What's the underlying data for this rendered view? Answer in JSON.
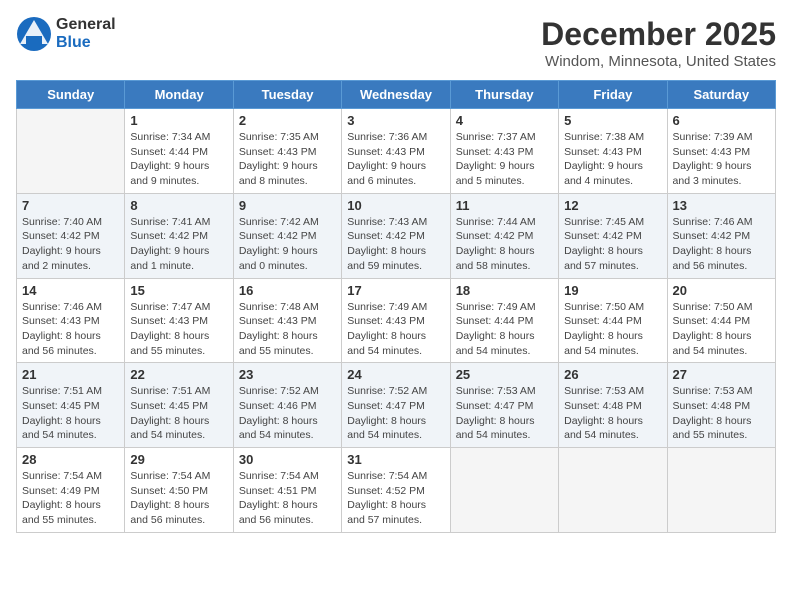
{
  "logo": {
    "general": "General",
    "blue": "Blue"
  },
  "header": {
    "title": "December 2025",
    "subtitle": "Windom, Minnesota, United States"
  },
  "weekdays": [
    "Sunday",
    "Monday",
    "Tuesday",
    "Wednesday",
    "Thursday",
    "Friday",
    "Saturday"
  ],
  "weeks": [
    [
      {
        "day": "",
        "empty": true
      },
      {
        "day": "1",
        "sunrise": "Sunrise: 7:34 AM",
        "sunset": "Sunset: 4:44 PM",
        "daylight": "Daylight: 9 hours and 9 minutes."
      },
      {
        "day": "2",
        "sunrise": "Sunrise: 7:35 AM",
        "sunset": "Sunset: 4:43 PM",
        "daylight": "Daylight: 9 hours and 8 minutes."
      },
      {
        "day": "3",
        "sunrise": "Sunrise: 7:36 AM",
        "sunset": "Sunset: 4:43 PM",
        "daylight": "Daylight: 9 hours and 6 minutes."
      },
      {
        "day": "4",
        "sunrise": "Sunrise: 7:37 AM",
        "sunset": "Sunset: 4:43 PM",
        "daylight": "Daylight: 9 hours and 5 minutes."
      },
      {
        "day": "5",
        "sunrise": "Sunrise: 7:38 AM",
        "sunset": "Sunset: 4:43 PM",
        "daylight": "Daylight: 9 hours and 4 minutes."
      },
      {
        "day": "6",
        "sunrise": "Sunrise: 7:39 AM",
        "sunset": "Sunset: 4:43 PM",
        "daylight": "Daylight: 9 hours and 3 minutes."
      }
    ],
    [
      {
        "day": "7",
        "sunrise": "Sunrise: 7:40 AM",
        "sunset": "Sunset: 4:42 PM",
        "daylight": "Daylight: 9 hours and 2 minutes."
      },
      {
        "day": "8",
        "sunrise": "Sunrise: 7:41 AM",
        "sunset": "Sunset: 4:42 PM",
        "daylight": "Daylight: 9 hours and 1 minute."
      },
      {
        "day": "9",
        "sunrise": "Sunrise: 7:42 AM",
        "sunset": "Sunset: 4:42 PM",
        "daylight": "Daylight: 9 hours and 0 minutes."
      },
      {
        "day": "10",
        "sunrise": "Sunrise: 7:43 AM",
        "sunset": "Sunset: 4:42 PM",
        "daylight": "Daylight: 8 hours and 59 minutes."
      },
      {
        "day": "11",
        "sunrise": "Sunrise: 7:44 AM",
        "sunset": "Sunset: 4:42 PM",
        "daylight": "Daylight: 8 hours and 58 minutes."
      },
      {
        "day": "12",
        "sunrise": "Sunrise: 7:45 AM",
        "sunset": "Sunset: 4:42 PM",
        "daylight": "Daylight: 8 hours and 57 minutes."
      },
      {
        "day": "13",
        "sunrise": "Sunrise: 7:46 AM",
        "sunset": "Sunset: 4:42 PM",
        "daylight": "Daylight: 8 hours and 56 minutes."
      }
    ],
    [
      {
        "day": "14",
        "sunrise": "Sunrise: 7:46 AM",
        "sunset": "Sunset: 4:43 PM",
        "daylight": "Daylight: 8 hours and 56 minutes."
      },
      {
        "day": "15",
        "sunrise": "Sunrise: 7:47 AM",
        "sunset": "Sunset: 4:43 PM",
        "daylight": "Daylight: 8 hours and 55 minutes."
      },
      {
        "day": "16",
        "sunrise": "Sunrise: 7:48 AM",
        "sunset": "Sunset: 4:43 PM",
        "daylight": "Daylight: 8 hours and 55 minutes."
      },
      {
        "day": "17",
        "sunrise": "Sunrise: 7:49 AM",
        "sunset": "Sunset: 4:43 PM",
        "daylight": "Daylight: 8 hours and 54 minutes."
      },
      {
        "day": "18",
        "sunrise": "Sunrise: 7:49 AM",
        "sunset": "Sunset: 4:44 PM",
        "daylight": "Daylight: 8 hours and 54 minutes."
      },
      {
        "day": "19",
        "sunrise": "Sunrise: 7:50 AM",
        "sunset": "Sunset: 4:44 PM",
        "daylight": "Daylight: 8 hours and 54 minutes."
      },
      {
        "day": "20",
        "sunrise": "Sunrise: 7:50 AM",
        "sunset": "Sunset: 4:44 PM",
        "daylight": "Daylight: 8 hours and 54 minutes."
      }
    ],
    [
      {
        "day": "21",
        "sunrise": "Sunrise: 7:51 AM",
        "sunset": "Sunset: 4:45 PM",
        "daylight": "Daylight: 8 hours and 54 minutes."
      },
      {
        "day": "22",
        "sunrise": "Sunrise: 7:51 AM",
        "sunset": "Sunset: 4:45 PM",
        "daylight": "Daylight: 8 hours and 54 minutes."
      },
      {
        "day": "23",
        "sunrise": "Sunrise: 7:52 AM",
        "sunset": "Sunset: 4:46 PM",
        "daylight": "Daylight: 8 hours and 54 minutes."
      },
      {
        "day": "24",
        "sunrise": "Sunrise: 7:52 AM",
        "sunset": "Sunset: 4:47 PM",
        "daylight": "Daylight: 8 hours and 54 minutes."
      },
      {
        "day": "25",
        "sunrise": "Sunrise: 7:53 AM",
        "sunset": "Sunset: 4:47 PM",
        "daylight": "Daylight: 8 hours and 54 minutes."
      },
      {
        "day": "26",
        "sunrise": "Sunrise: 7:53 AM",
        "sunset": "Sunset: 4:48 PM",
        "daylight": "Daylight: 8 hours and 54 minutes."
      },
      {
        "day": "27",
        "sunrise": "Sunrise: 7:53 AM",
        "sunset": "Sunset: 4:48 PM",
        "daylight": "Daylight: 8 hours and 55 minutes."
      }
    ],
    [
      {
        "day": "28",
        "sunrise": "Sunrise: 7:54 AM",
        "sunset": "Sunset: 4:49 PM",
        "daylight": "Daylight: 8 hours and 55 minutes."
      },
      {
        "day": "29",
        "sunrise": "Sunrise: 7:54 AM",
        "sunset": "Sunset: 4:50 PM",
        "daylight": "Daylight: 8 hours and 56 minutes."
      },
      {
        "day": "30",
        "sunrise": "Sunrise: 7:54 AM",
        "sunset": "Sunset: 4:51 PM",
        "daylight": "Daylight: 8 hours and 56 minutes."
      },
      {
        "day": "31",
        "sunrise": "Sunrise: 7:54 AM",
        "sunset": "Sunset: 4:52 PM",
        "daylight": "Daylight: 8 hours and 57 minutes."
      },
      {
        "day": "",
        "empty": true
      },
      {
        "day": "",
        "empty": true
      },
      {
        "day": "",
        "empty": true
      }
    ]
  ]
}
